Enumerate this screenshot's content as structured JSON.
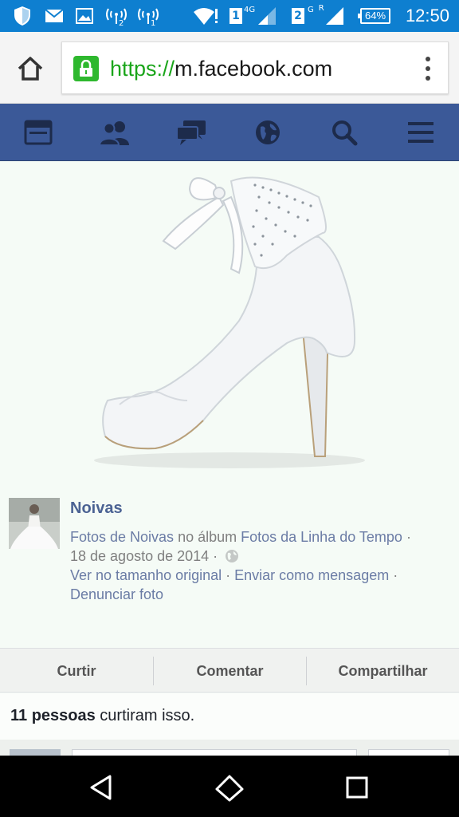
{
  "status_bar": {
    "sim1_label": "1",
    "sim1_net": "4G",
    "sim2_label": "2",
    "sim2_net": "G",
    "sim2_roam": "R",
    "battery": "64%",
    "time": "12:50"
  },
  "browser": {
    "url_protocol": "https://",
    "url_host": "m.facebook.com"
  },
  "fb_nav": {
    "items": [
      "news-feed-icon",
      "friends-icon",
      "messages-icon",
      "notifications-globe-icon",
      "search-icon",
      "menu-icon"
    ]
  },
  "post": {
    "page_name": "Noivas",
    "album_owner": "Fotos de Noivas",
    "in_album": " no álbum ",
    "album_name": "Fotos da Linha do Tempo",
    "dot": " ·",
    "date": "18 de agosto de 2014 ·",
    "view_original": "Ver no tamanho original",
    "sep": " · ",
    "send_message": "Enviar como mensagem",
    "trailing_dot": " ·",
    "report_photo": "Denunciar foto"
  },
  "actions": {
    "like": "Curtir",
    "comment": "Comentar",
    "share": "Compartilhar"
  },
  "likes": {
    "count": "11 pessoas",
    "suffix": " curtiram isso."
  },
  "colors": {
    "status_bar": "#0e7fd0",
    "fb_blue": "#3b5998",
    "link": "#4b6293",
    "https_green": "#1aa51a"
  }
}
